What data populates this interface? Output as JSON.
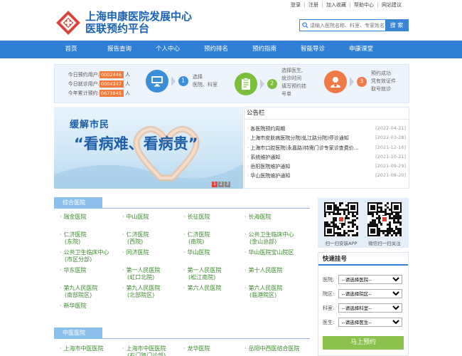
{
  "top_links": [
    "登录",
    "注册",
    "加入收藏",
    "帮助中心",
    "网站建议"
  ],
  "logo": {
    "line1": "上海申康医院发展中心",
    "line2": "医联预约平台"
  },
  "search": {
    "placeholder": "请输入医院名称、科室、专家姓名",
    "button": "搜 索"
  },
  "nav": [
    "首页",
    "报告查询",
    "个人中心",
    "预约排名",
    "预约指南",
    "智能导诊",
    "申康课堂"
  ],
  "stats": [
    {
      "label": "今日预约用户:",
      "value": "0002446",
      "unit": "人"
    },
    {
      "label": "今日就诊用户:",
      "value": "0004347",
      "unit": "人"
    },
    {
      "label": "今年累计预约:",
      "value": "0673845",
      "unit": "人"
    }
  ],
  "steps": [
    {
      "num": "1",
      "lines": [
        "选择",
        "医院、科室"
      ],
      "icon": "monitor-icon",
      "color": "#3b8ed8"
    },
    {
      "num": "2",
      "lines": [
        "选择医生,",
        "就诊时间",
        "填写预约挂",
        "号单"
      ],
      "icon": "clipboard-icon",
      "color": "#7bbf3c"
    },
    {
      "num": "3",
      "lines": [
        "预约成功",
        "凭有效证件",
        "取号就诊"
      ],
      "icon": "doctor-icon",
      "color": "#f07a45"
    }
  ],
  "banner": {
    "line1": "缓解市民",
    "line2": "“看病难、看病贵”",
    "pages": [
      "1",
      "2",
      "3"
    ]
  },
  "notice": {
    "title": "公告栏",
    "items": [
      {
        "title": "各医院预约周期",
        "date": "[2022-04-21]"
      },
      {
        "title": "上海市皮肤病医院分院(虬江路分院)停诊通知",
        "date": "[2022-03-28]"
      },
      {
        "title": "上海市口腔医院(永嘉路)特需门诊专家诊查费价...",
        "date": "[2021-12-16]"
      },
      {
        "title": "系统维护通知",
        "date": "[2021-10-21]"
      },
      {
        "title": "岳阳医院维护通知",
        "date": "[2021-09-29]"
      },
      {
        "title": "华山医院维护通知",
        "date": "[2021-08-20]"
      }
    ]
  },
  "general_hospitals": {
    "title": "综合医院",
    "items": [
      {
        "name": "瑞金医院",
        "sub": ""
      },
      {
        "name": "中山医院",
        "sub": ""
      },
      {
        "name": "长征医院",
        "sub": ""
      },
      {
        "name": "长海医院",
        "sub": ""
      },
      {
        "name": "仁济医院",
        "sub": "(东院)"
      },
      {
        "name": "仁济医院",
        "sub": "(西院)"
      },
      {
        "name": "仁济医院",
        "sub": "(南院)"
      },
      {
        "name": "公共卫生临床中心",
        "sub": "(金山总部)"
      },
      {
        "name": "公共卫生临床中心",
        "sub": "(市区分部)"
      },
      {
        "name": "同济医院",
        "sub": ""
      },
      {
        "name": "华山医院",
        "sub": ""
      },
      {
        "name": "华山医院宝山院区",
        "sub": ""
      },
      {
        "name": "华东医院",
        "sub": ""
      },
      {
        "name": "第一人民医院",
        "sub": "(虹口北院)"
      },
      {
        "name": "第一人民医院",
        "sub": "(松江南院)"
      },
      {
        "name": "第十人民医院",
        "sub": ""
      },
      {
        "name": "第九人民医院",
        "sub": "(南部院区)"
      },
      {
        "name": "第九人民医院",
        "sub": "(北部院区)"
      },
      {
        "name": "第六人民医院",
        "sub": ""
      },
      {
        "name": "第六人民医院",
        "sub": "(临港院区)"
      },
      {
        "name": "新华医院",
        "sub": ""
      }
    ]
  },
  "tcm_hospitals": {
    "title": "中医医院",
    "items": [
      {
        "name": "上海市中医医院",
        "sub": ""
      },
      {
        "name": "上海市中医医院",
        "sub": "(石门路门诊部)"
      },
      {
        "name": "龙华医院",
        "sub": ""
      },
      {
        "name": "岳阳中西医结合医院",
        "sub": ""
      }
    ]
  },
  "qr": [
    {
      "caption": "扫一扫安装APP"
    },
    {
      "caption": "微信扫一扫关注"
    }
  ],
  "quick": {
    "title": "快速挂号",
    "fields": [
      {
        "label": "医院:",
        "value": "--请选择医院--"
      },
      {
        "label": "院区:",
        "value": "--请选择院区--"
      },
      {
        "label": "科室:",
        "value": "--请选择科室--"
      },
      {
        "label": "医生:",
        "value": "--请选择医生--"
      }
    ],
    "button": "马上预约"
  },
  "colors": {
    "nav": "#2f80d4",
    "accent_orange": "#f27a3d",
    "link_green": "#3d8a2e",
    "button_green": "#8cc14b"
  }
}
